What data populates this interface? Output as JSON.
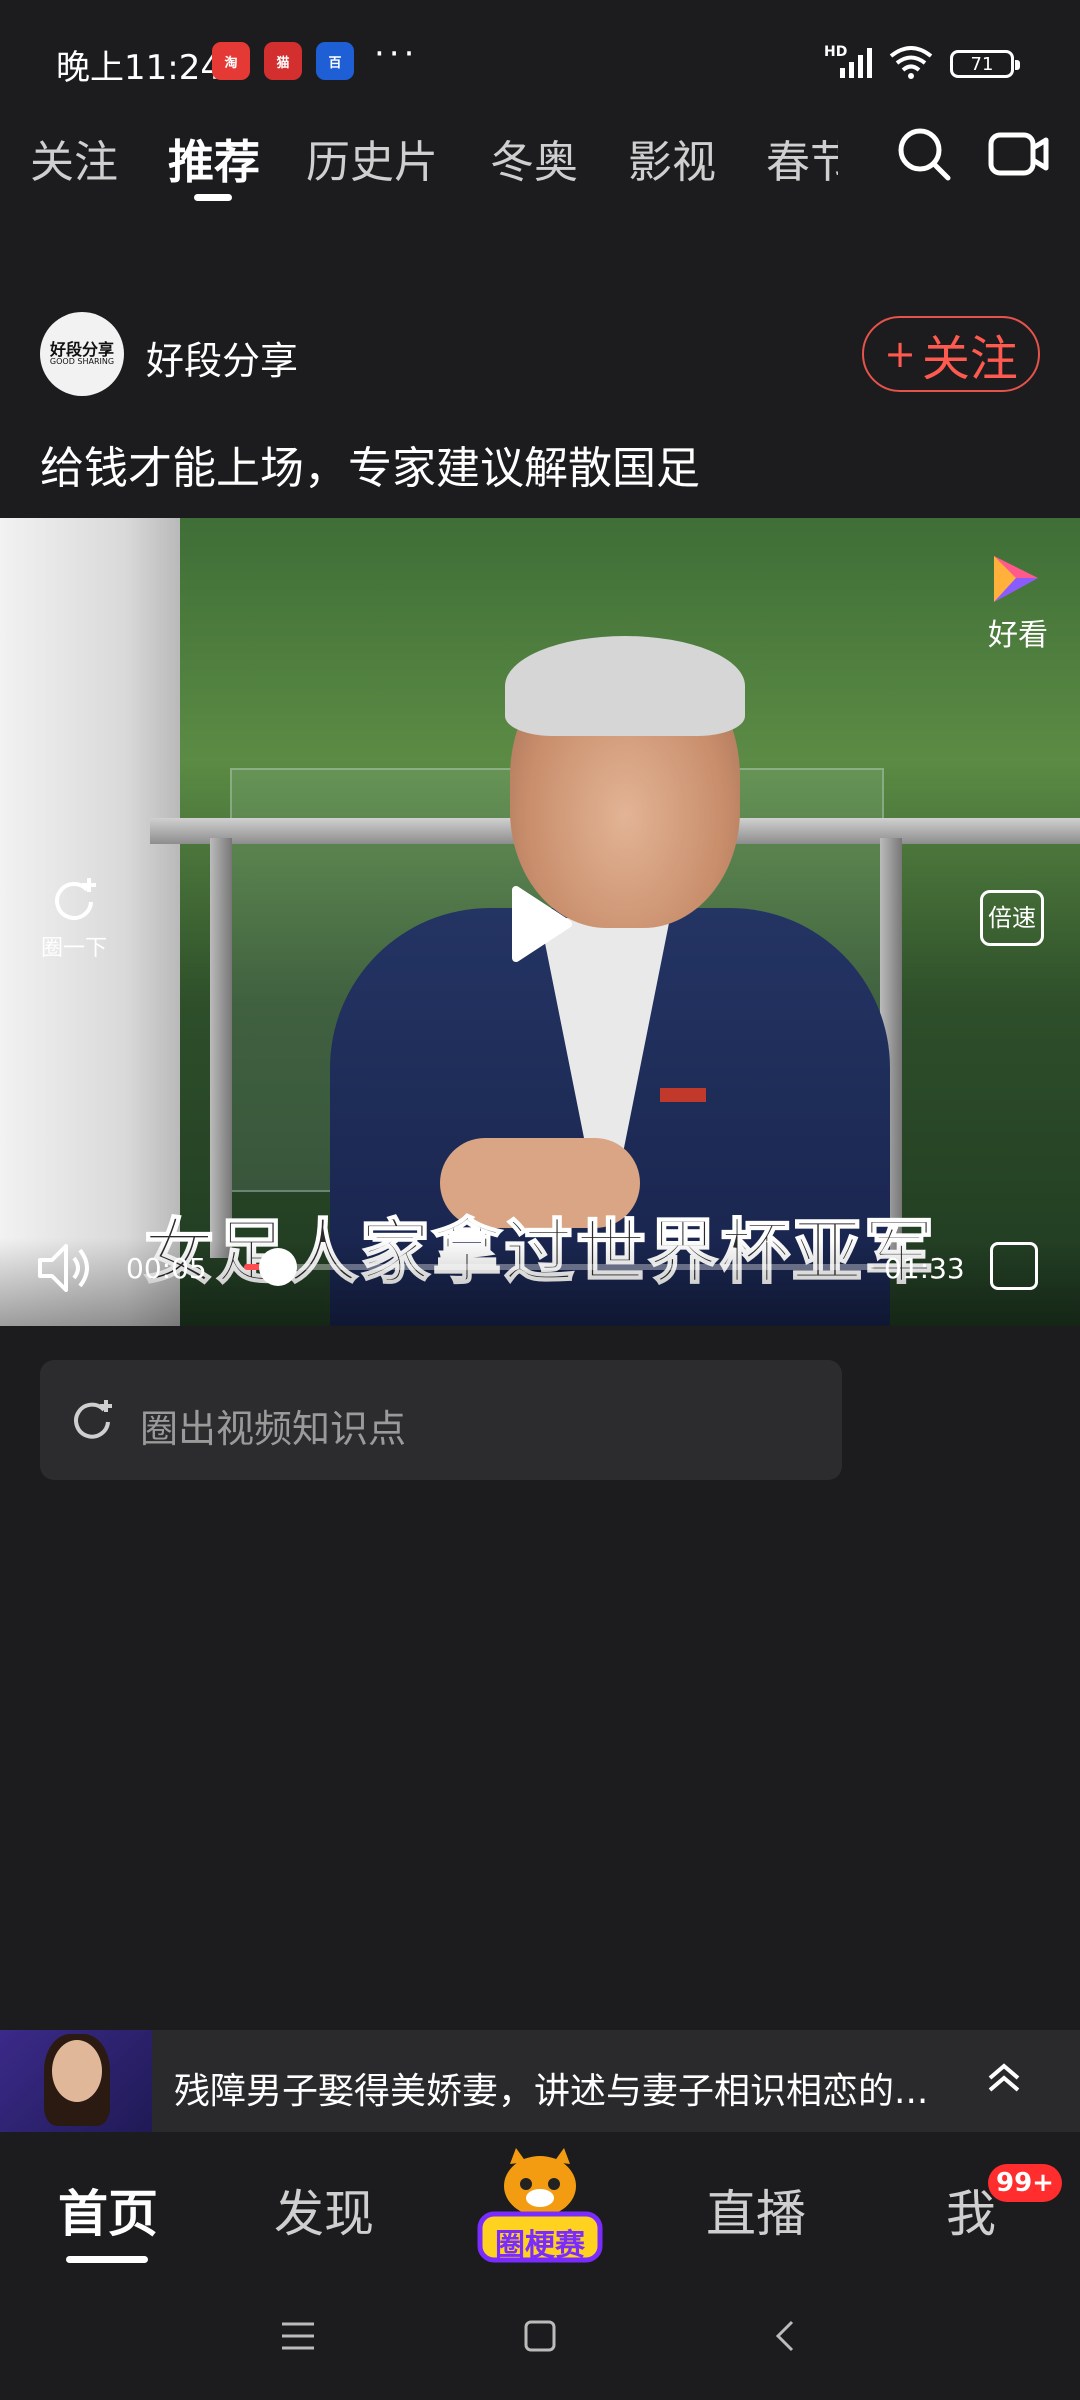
{
  "status_bar": {
    "time": "晚上11:24",
    "app_icons": [
      "taobao-icon",
      "tmall-icon",
      "baidu-icon"
    ],
    "more": "···",
    "network": "HD",
    "battery": "71"
  },
  "top_tabs": {
    "items": [
      "关注",
      "推荐",
      "历史片",
      "冬奥",
      "影视",
      "春节"
    ],
    "active_index": 1
  },
  "post": {
    "author": "好段分享",
    "avatar_text": "好段分享",
    "avatar_subtext": "GOOD SHARING",
    "follow_label": "关注",
    "title": "给钱才能上场，专家建议解散国足"
  },
  "video": {
    "subtitle": "女足人家拿过世界杯亚军",
    "watermark": "好看",
    "replay_label": "圈一下",
    "speed_label": "倍速",
    "current_time": "00:05",
    "duration": "01:33",
    "progress": 0.054
  },
  "knowledge_point": {
    "label": "圈出视频知识点"
  },
  "recommendation": {
    "text": "残障男子娶得美娇妻，讲述与妻子相识相恋的..."
  },
  "bottom_nav": {
    "items": [
      "首页",
      "发现",
      "",
      "直播",
      "我"
    ],
    "active_index": 0,
    "mascot_label": "圈梗赛",
    "badge": "99+"
  },
  "colors": {
    "background": "#1c1c1e",
    "accent_red": "#ff5a4f",
    "progress_red": "#ff4d4f"
  }
}
